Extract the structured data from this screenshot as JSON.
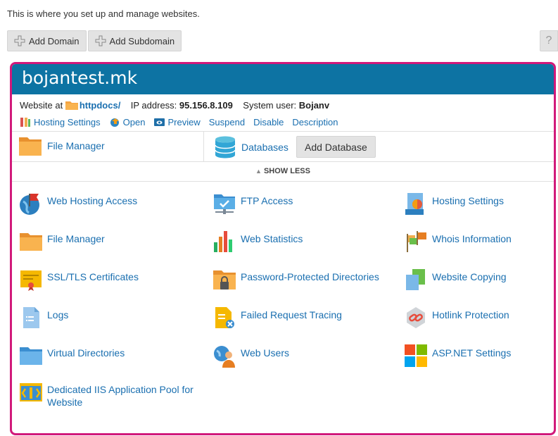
{
  "intro": "This is where you set up and manage websites.",
  "toolbar": {
    "add_domain": "Add Domain",
    "add_subdomain": "Add Subdomain",
    "help": "?"
  },
  "domain": {
    "name": "bojantest.mk",
    "website_at_label": "Website at",
    "docroot": "httpdocs/",
    "ip_label": "IP address:",
    "ip": "95.156.8.109",
    "user_label": "System user:",
    "user": "Bojanv"
  },
  "actions": {
    "hosting_settings": "Hosting Settings",
    "open": "Open",
    "preview": "Preview",
    "suspend": "Suspend",
    "disable": "Disable",
    "description": "Description"
  },
  "quick": {
    "file_manager": "File Manager",
    "databases": "Databases",
    "add_database": "Add Database"
  },
  "show_less": "SHOW LESS",
  "tools": [
    {
      "label": "Web Hosting Access",
      "icon": "web-hosting-access-icon"
    },
    {
      "label": "FTP Access",
      "icon": "ftp-access-icon"
    },
    {
      "label": "Hosting Settings",
      "icon": "hosting-settings-icon"
    },
    {
      "label": "File Manager",
      "icon": "folder-icon"
    },
    {
      "label": "Web Statistics",
      "icon": "bar-chart-icon"
    },
    {
      "label": "Whois Information",
      "icon": "flags-icon"
    },
    {
      "label": "SSL/TLS Certificates",
      "icon": "certificate-icon"
    },
    {
      "label": "Password-Protected Directories",
      "icon": "locked-folder-icon"
    },
    {
      "label": "Website Copying",
      "icon": "copy-icon"
    },
    {
      "label": "Logs",
      "icon": "log-file-icon"
    },
    {
      "label": "Failed Request Tracing",
      "icon": "failed-request-icon"
    },
    {
      "label": "Hotlink Protection",
      "icon": "hotlink-icon"
    },
    {
      "label": "Virtual Directories",
      "icon": "folder-icon"
    },
    {
      "label": "Web Users",
      "icon": "web-users-icon"
    },
    {
      "label": "ASP.NET Settings",
      "icon": "aspnet-icon"
    },
    {
      "label": "Dedicated IIS Application Pool for Website",
      "icon": "app-pool-icon"
    }
  ],
  "colors": {
    "header": "#0d73a3",
    "highlight_border": "#d1197a",
    "link": "#1a6fb0",
    "folder": "#f5a442"
  }
}
